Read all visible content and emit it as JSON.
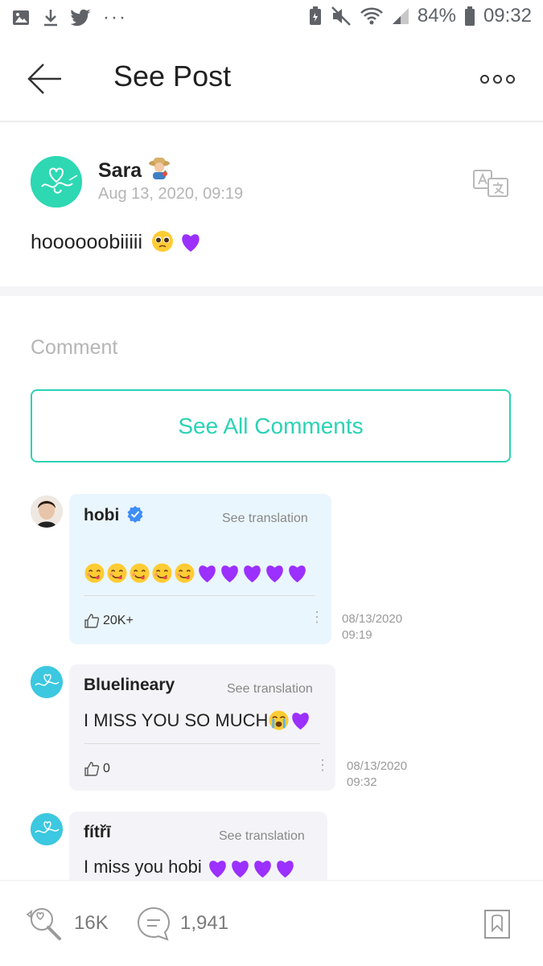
{
  "status_bar": {
    "battery": "84%",
    "time": "09:32"
  },
  "header": {
    "title": "See Post"
  },
  "post": {
    "author": "Sara",
    "date": "Aug 13, 2020, 09:19",
    "body": "hoooooobiiiii"
  },
  "comments_section": {
    "label": "Comment",
    "see_all": "See All Comments",
    "items": [
      {
        "name": "hobi",
        "translate": "See translation",
        "text": "",
        "likes": "20K+",
        "date": "08/13/2020",
        "time": "09:19"
      },
      {
        "name": "Bluelineary",
        "translate": "See translation",
        "text": "I MISS YOU SO MUCH",
        "likes": "0",
        "date": "08/13/2020",
        "time": "09:32"
      },
      {
        "name": "fítřī",
        "translate": "See translation",
        "text": "I miss you hobi"
      }
    ]
  },
  "bottom_bar": {
    "cheer_count": "16K",
    "comment_count": "1,941"
  },
  "colors": {
    "accent": "#2ad3b4",
    "verified": "#3e8ef7",
    "heart": "#9b30ff",
    "hobi_bubble": "#eaf6fd",
    "bubble": "#f4f4f8"
  }
}
